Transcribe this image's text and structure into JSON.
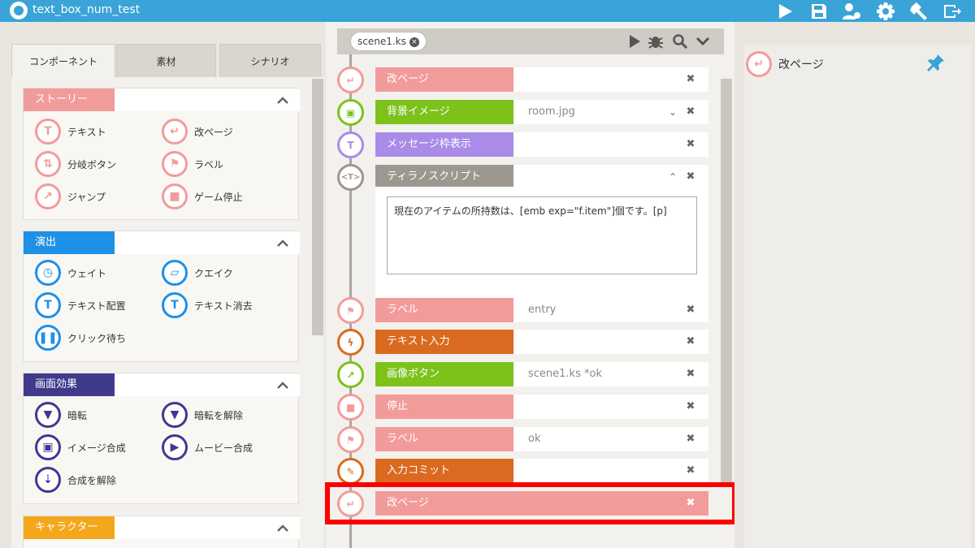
{
  "app": {
    "title": "text_box_num_test"
  },
  "toolbar": {
    "icons": [
      "play-icon",
      "save-icon",
      "user-settings-icon",
      "gear-icon",
      "hammer-icon",
      "exit-icon"
    ]
  },
  "left": {
    "tabs": [
      "コンポーネント",
      "素材",
      "シナリオ"
    ],
    "groups": [
      {
        "label": "ストーリー",
        "color": "#f29b9b",
        "items": [
          "テキスト",
          "改ページ",
          "分岐ボタン",
          "ラベル",
          "ジャンプ",
          "ゲーム停止"
        ]
      },
      {
        "label": "演出",
        "color": "#1e90e6",
        "items": [
          "ウェイト",
          "クエイク",
          "テキスト配置",
          "テキスト消去",
          "クリック待ち"
        ]
      },
      {
        "label": "画面効果",
        "color": "#3f3a8c",
        "items": [
          "暗転",
          "暗転を解除",
          "イメージ合成",
          "ムービー合成",
          "合成を解除"
        ]
      },
      {
        "label": "キャラクター",
        "color": "#f5a71c",
        "items": []
      }
    ]
  },
  "center": {
    "file_tab": "scene1.ks",
    "rows": [
      {
        "label": "改ページ",
        "value": "",
        "color": "#f29b9b"
      },
      {
        "label": "背景イメージ",
        "value": "room.jpg",
        "color": "#7cc21b"
      },
      {
        "label": "メッセージ枠表示",
        "value": "",
        "color": "#a98be8"
      },
      {
        "label": "ティラノスクリプト",
        "value": "",
        "color": "#9c9890"
      },
      {
        "label": "ラベル",
        "value": "entry",
        "color": "#f29b9b"
      },
      {
        "label": "テキスト入力",
        "value": "",
        "color": "#d96a1f"
      },
      {
        "label": "画像ボタン",
        "value": "scene1.ks *ok",
        "color": "#7cc21b"
      },
      {
        "label": "停止",
        "value": "",
        "color": "#f29b9b"
      },
      {
        "label": "ラベル",
        "value": "ok",
        "color": "#f29b9b"
      },
      {
        "label": "入力コミット",
        "value": "",
        "color": "#d96a1f"
      },
      {
        "label": "改ページ",
        "value": "",
        "color": "#f29b9b"
      }
    ],
    "script_text": "現在のアイテムの所持数は、[emb exp=\"f.item\"]個です。[p]",
    "delete_symbol": "✖"
  },
  "right": {
    "title": "改ページ"
  }
}
